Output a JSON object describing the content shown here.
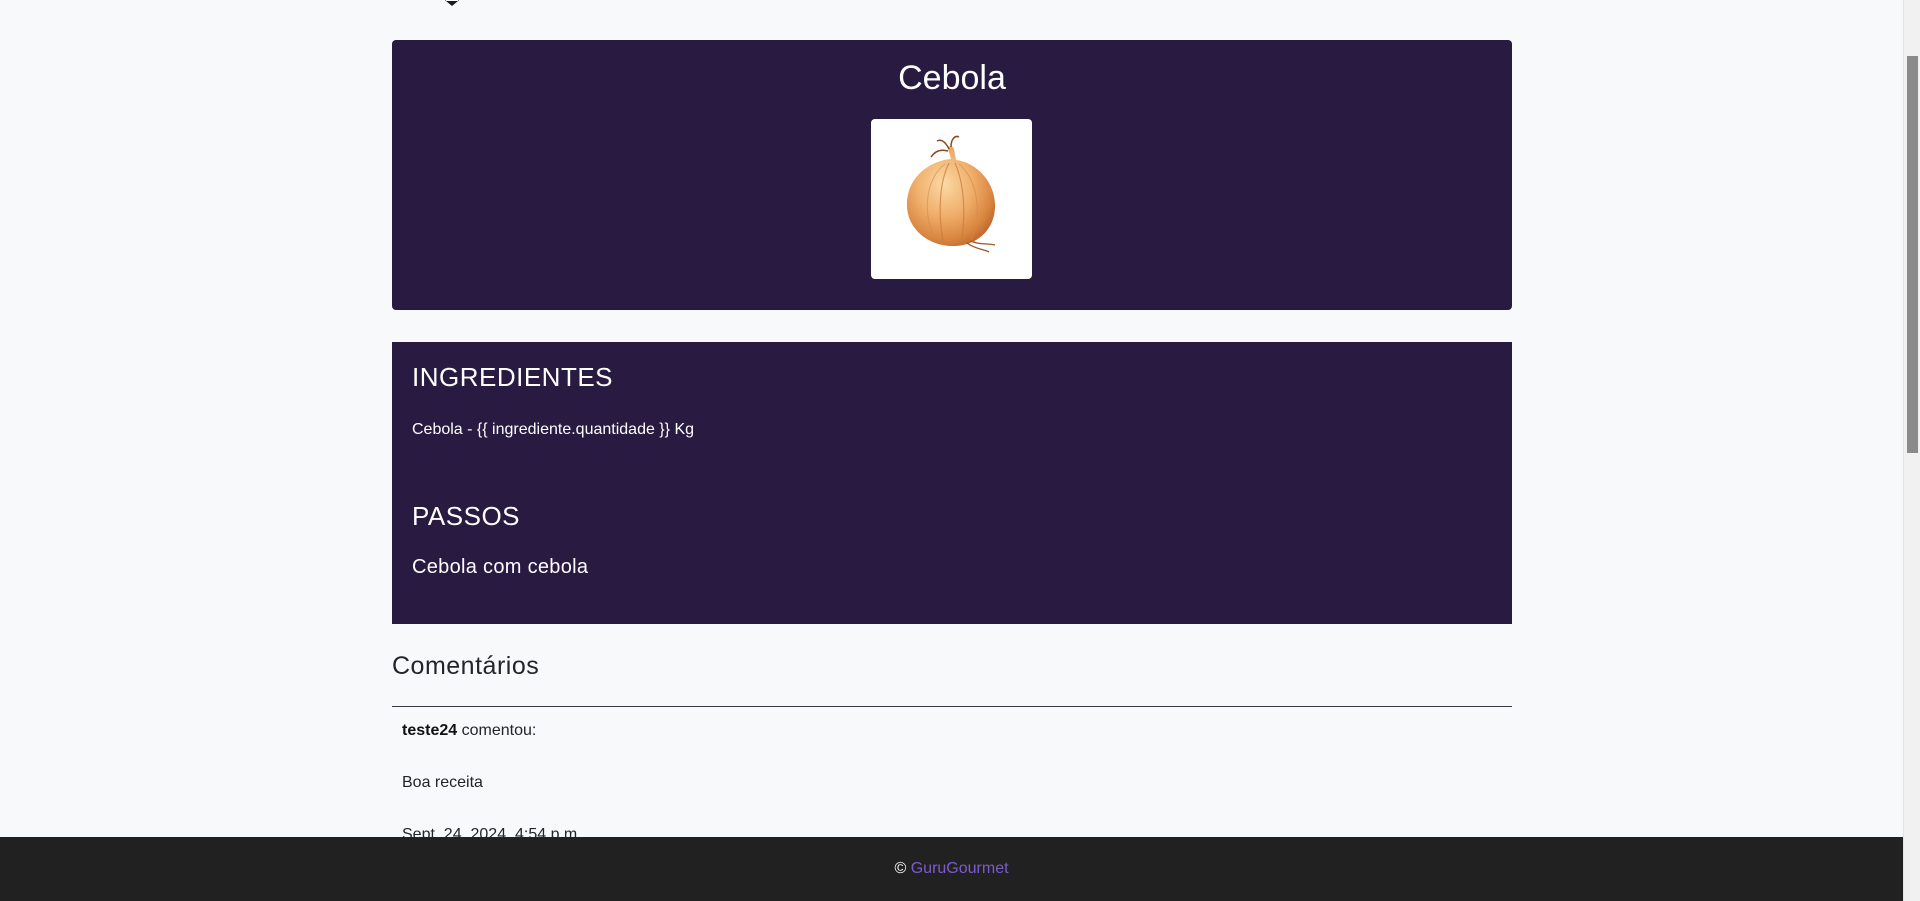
{
  "recipe": {
    "title": "Cebola",
    "image_alt": "onion-image"
  },
  "ingredients": {
    "heading": "INGREDIENTES",
    "line": "Cebola - {{ ingrediente.quantidade }} Kg"
  },
  "steps": {
    "heading": "PASSOS",
    "text": "Cebola com cebola"
  },
  "comments": {
    "title": "Comentários",
    "items": [
      {
        "author": "teste24",
        "verb": "comentou:",
        "text": "Boa receita",
        "date": "Sept. 24, 2024, 4:54 p.m."
      }
    ]
  },
  "footer": {
    "copyright_symbol": "©",
    "brand": "GuruGourmet"
  },
  "colors": {
    "card_bg": "#281a40",
    "page_bg": "#f8f9fb",
    "footer_bg": "#212121",
    "footer_link": "#7b5ccc"
  }
}
